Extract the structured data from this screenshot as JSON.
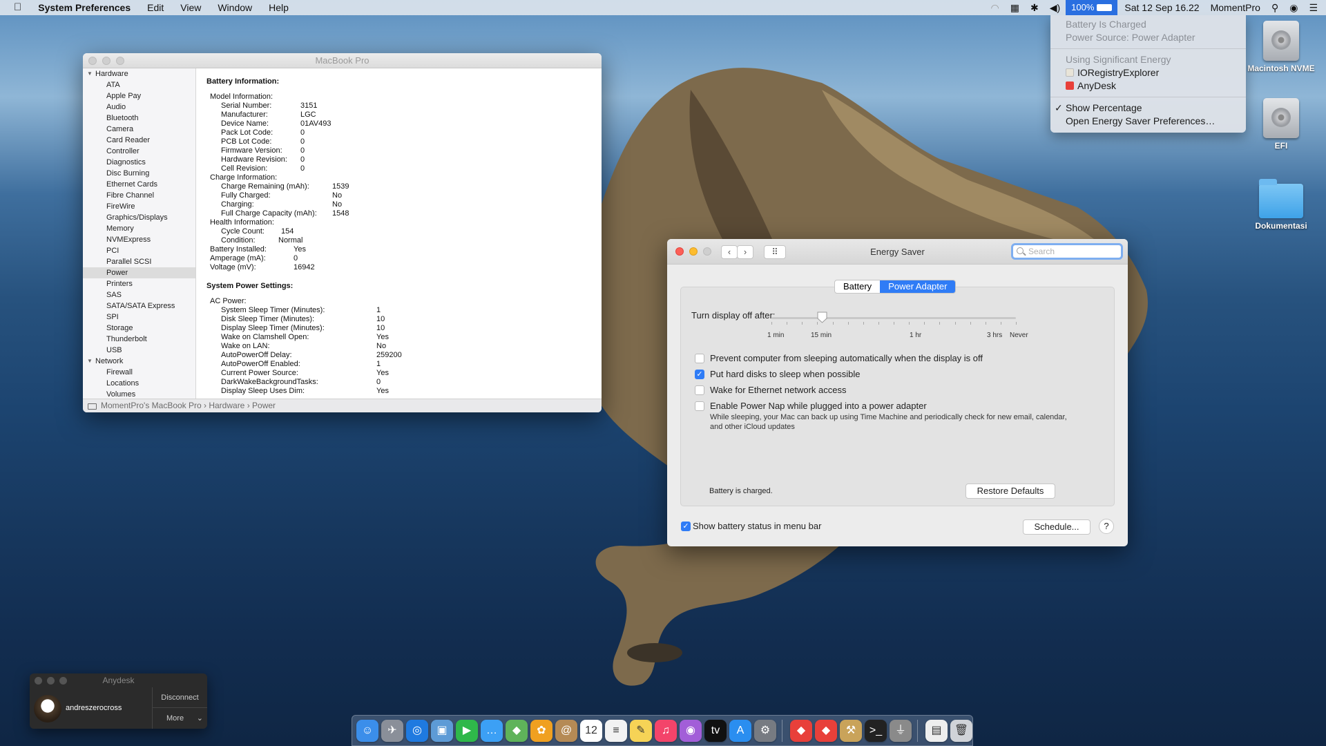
{
  "menubar": {
    "app_name": "System Preferences",
    "menus": [
      "Edit",
      "View",
      "Window",
      "Help"
    ],
    "battery_percent": "100%",
    "datetime": "Sat 12 Sep  16.22",
    "user": "MomentPro"
  },
  "battery_menu": {
    "status": "Battery Is Charged",
    "power_source": "Power Source: Power Adapter",
    "significant_header": "Using Significant Energy",
    "apps": [
      "IORegistryExplorer",
      "AnyDesk"
    ],
    "show_percentage": "Show Percentage",
    "open_prefs": "Open Energy Saver Preferences…",
    "check": "✓"
  },
  "desktop": {
    "icons": [
      "Macintosh NVME",
      "EFI",
      "Dokumentasi"
    ]
  },
  "sysinfo": {
    "title": "MacBook Pro",
    "sidebar": {
      "hardware_label": "Hardware",
      "hardware_items": [
        "ATA",
        "Apple Pay",
        "Audio",
        "Bluetooth",
        "Camera",
        "Card Reader",
        "Controller",
        "Diagnostics",
        "Disc Burning",
        "Ethernet Cards",
        "Fibre Channel",
        "FireWire",
        "Graphics/Displays",
        "Memory",
        "NVMExpress",
        "PCI",
        "Parallel SCSI",
        "Power",
        "Printers",
        "SAS",
        "SATA/SATA Express",
        "SPI",
        "Storage",
        "Thunderbolt",
        "USB"
      ],
      "network_label": "Network",
      "network_items": [
        "Firewall",
        "Locations",
        "Volumes"
      ]
    },
    "battery_heading": "Battery Information:",
    "battery_rows": [
      {
        "k": "Model Information:",
        "v": "",
        "i": 0,
        "c": 0
      },
      {
        "k": "Serial Number:",
        "v": "3151",
        "i": 1,
        "c": 0
      },
      {
        "k": "Manufacturer:",
        "v": "LGC",
        "i": 1,
        "c": 0
      },
      {
        "k": "Device Name:",
        "v": "01AV493",
        "i": 1,
        "c": 0
      },
      {
        "k": "Pack Lot Code:",
        "v": "0",
        "i": 1,
        "c": 0
      },
      {
        "k": "PCB Lot Code:",
        "v": "0",
        "i": 1,
        "c": 0
      },
      {
        "k": "Firmware Version:",
        "v": "0",
        "i": 1,
        "c": 0
      },
      {
        "k": "Hardware Revision:",
        "v": "0",
        "i": 1,
        "c": 0
      },
      {
        "k": "Cell Revision:",
        "v": "0",
        "i": 1,
        "c": 0
      },
      {
        "k": "Charge Information:",
        "v": "",
        "i": 0,
        "c": 0
      },
      {
        "k": "Charge Remaining (mAh):",
        "v": "1539",
        "i": 1,
        "c": 1
      },
      {
        "k": "Fully Charged:",
        "v": "No",
        "i": 1,
        "c": 1
      },
      {
        "k": "Charging:",
        "v": "No",
        "i": 1,
        "c": 1
      },
      {
        "k": "Full Charge Capacity (mAh):",
        "v": "1548",
        "i": 1,
        "c": 1
      },
      {
        "k": "Health Information:",
        "v": "",
        "i": 0,
        "c": 0
      },
      {
        "k": "Cycle Count:",
        "v": "154",
        "i": 1,
        "c": 2
      },
      {
        "k": "Condition:",
        "v": "Normal",
        "i": 1,
        "c": 3
      },
      {
        "k": "Battery Installed:",
        "v": "Yes",
        "i": 0,
        "c": 4
      },
      {
        "k": "Amperage (mA):",
        "v": "0",
        "i": 0,
        "c": 4
      },
      {
        "k": "Voltage (mV):",
        "v": "16942",
        "i": 0,
        "c": 4
      }
    ],
    "power_heading": "System Power Settings:",
    "power_rows": [
      {
        "k": "AC Power:",
        "v": "",
        "i": 0
      },
      {
        "k": "System Sleep Timer (Minutes):",
        "v": "1",
        "i": 1
      },
      {
        "k": "Disk Sleep Timer (Minutes):",
        "v": "10",
        "i": 1
      },
      {
        "k": "Display Sleep Timer (Minutes):",
        "v": "10",
        "i": 1
      },
      {
        "k": "Wake on Clamshell Open:",
        "v": "Yes",
        "i": 1
      },
      {
        "k": "Wake on LAN:",
        "v": "No",
        "i": 1
      },
      {
        "k": "AutoPowerOff Delay:",
        "v": "259200",
        "i": 1
      },
      {
        "k": "AutoPowerOff Enabled:",
        "v": "1",
        "i": 1
      },
      {
        "k": "Current Power Source:",
        "v": "Yes",
        "i": 1
      },
      {
        "k": "DarkWakeBackgroundTasks:",
        "v": "0",
        "i": 1
      },
      {
        "k": "Display Sleep Uses Dim:",
        "v": "Yes",
        "i": 1
      }
    ],
    "breadcrumb": "MomentPro's MacBook Pro  ›  Hardware  ›  Power"
  },
  "energy": {
    "title": "Energy Saver",
    "search_placeholder": "Search",
    "tabs": [
      "Battery",
      "Power Adapter"
    ],
    "active_tab": 1,
    "slider_label": "Turn display off after:",
    "slider_value_minutes": 10,
    "tick_labels": [
      "1 min",
      "15 min",
      "1 hr",
      "3 hrs",
      "Never"
    ],
    "options": [
      {
        "label": "Prevent computer from sleeping automatically when the display is off",
        "checked": false
      },
      {
        "label": "Put hard disks to sleep when possible",
        "checked": true
      },
      {
        "label": "Wake for Ethernet network access",
        "checked": false
      },
      {
        "label": "Enable Power Nap while plugged into a power adapter",
        "checked": false
      }
    ],
    "powernap_desc": "While sleeping, your Mac can back up using Time Machine and periodically check for new email, calendar, and other iCloud updates",
    "battery_status": "Battery is charged.",
    "restore_defaults": "Restore Defaults",
    "show_battery": "Show battery status in menu bar",
    "show_battery_checked": true,
    "schedule": "Schedule...",
    "help": "?",
    "check": "✓"
  },
  "anydesk": {
    "title": "Anydesk",
    "user": "andreszerocross",
    "disconnect": "Disconnect",
    "more": "More"
  },
  "dock": {
    "icons": [
      {
        "name": "finder",
        "color": "#3b8eea",
        "g": "☺"
      },
      {
        "name": "launchpad",
        "color": "#8a8f99",
        "g": "✈"
      },
      {
        "name": "safari",
        "color": "#1f7ae0",
        "g": "◎"
      },
      {
        "name": "preview",
        "color": "#5d9bd6",
        "g": "▣"
      },
      {
        "name": "facetime",
        "color": "#2fb84a",
        "g": "▶"
      },
      {
        "name": "messages",
        "color": "#3ca0f5",
        "g": "…"
      },
      {
        "name": "maps",
        "color": "#5fb35a",
        "g": "◆"
      },
      {
        "name": "photos",
        "color": "#f0a020",
        "g": "✿"
      },
      {
        "name": "contacts",
        "color": "#b58a55",
        "g": "@"
      },
      {
        "name": "calendar",
        "color": "#ffffff",
        "g": "12"
      },
      {
        "name": "reminders",
        "color": "#f2f2f2",
        "g": "≡"
      },
      {
        "name": "notes",
        "color": "#f6d356",
        "g": "✎"
      },
      {
        "name": "music",
        "color": "#f3446a",
        "g": "♫"
      },
      {
        "name": "podcasts",
        "color": "#a25ed8",
        "g": "◉"
      },
      {
        "name": "tv",
        "color": "#111111",
        "g": "tv"
      },
      {
        "name": "app-store",
        "color": "#2a8ef0",
        "g": "A"
      },
      {
        "name": "system-preferences",
        "color": "#777b82",
        "g": "⚙"
      },
      {
        "name": "anydesk",
        "color": "#e8403a",
        "g": "◆"
      },
      {
        "name": "anydesk-2",
        "color": "#e8403a",
        "g": "◆"
      },
      {
        "name": "utility",
        "color": "#c9a35a",
        "g": "⚒"
      },
      {
        "name": "terminal",
        "color": "#222222",
        "g": ">_"
      },
      {
        "name": "tool",
        "color": "#8a8a8a",
        "g": "⏚"
      },
      {
        "name": "documents",
        "color": "#eeeeee",
        "g": "▤"
      },
      {
        "name": "trash",
        "color": "#d0d3d8",
        "g": "🗑"
      }
    ]
  }
}
